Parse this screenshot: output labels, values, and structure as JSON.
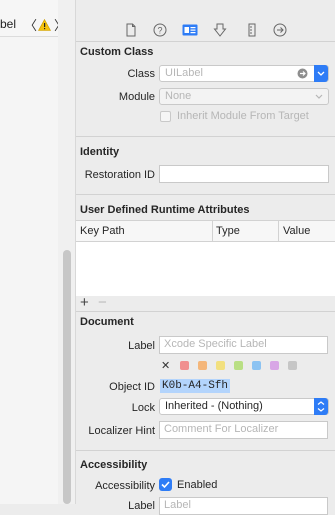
{
  "editor": {
    "title_fragment": "bel",
    "back_glyph": "〈",
    "forward_glyph": "〉",
    "corner_plus": "+"
  },
  "tabs": [
    {
      "name": "file-inspector-icon"
    },
    {
      "name": "quick-help-icon"
    },
    {
      "name": "identity-inspector-icon",
      "selected": true
    },
    {
      "name": "attributes-inspector-icon"
    },
    {
      "name": "size-inspector-icon"
    },
    {
      "name": "connections-inspector-icon"
    }
  ],
  "custom_class": {
    "title": "Custom Class",
    "class_label": "Class",
    "class_placeholder": "UILabel",
    "module_label": "Module",
    "module_value": "None",
    "inherit_label": "Inherit Module From Target"
  },
  "identity": {
    "title": "Identity",
    "restoration_label": "Restoration ID",
    "restoration_value": ""
  },
  "runtime_attributes": {
    "title": "User Defined Runtime Attributes",
    "columns": [
      "Key Path",
      "Type",
      "Value"
    ],
    "add_glyph": "+",
    "remove_glyph": "−"
  },
  "document": {
    "title": "Document",
    "label_label": "Label",
    "label_placeholder": "Xcode Specific Label",
    "clear_glyph": "✕",
    "swatches": [
      "#f08f8f",
      "#f4b67a",
      "#f2e07f",
      "#b9df84",
      "#8cc3f2",
      "#d8a6e6",
      "#c6c6c6"
    ],
    "object_id_label": "Object ID",
    "object_id_value": "K0b-A4-Sfh",
    "lock_label": "Lock",
    "lock_value": "Inherited - (Nothing)",
    "localizer_label": "Localizer Hint",
    "localizer_placeholder": "Comment For Localizer"
  },
  "accessibility": {
    "title": "Accessibility",
    "accessibility_label": "Accessibility",
    "enabled_label": "Enabled",
    "label_label": "Label",
    "label_placeholder": "Label"
  },
  "colors": {
    "accent": "#2e7cf6",
    "selection": "#b3d4fc"
  }
}
